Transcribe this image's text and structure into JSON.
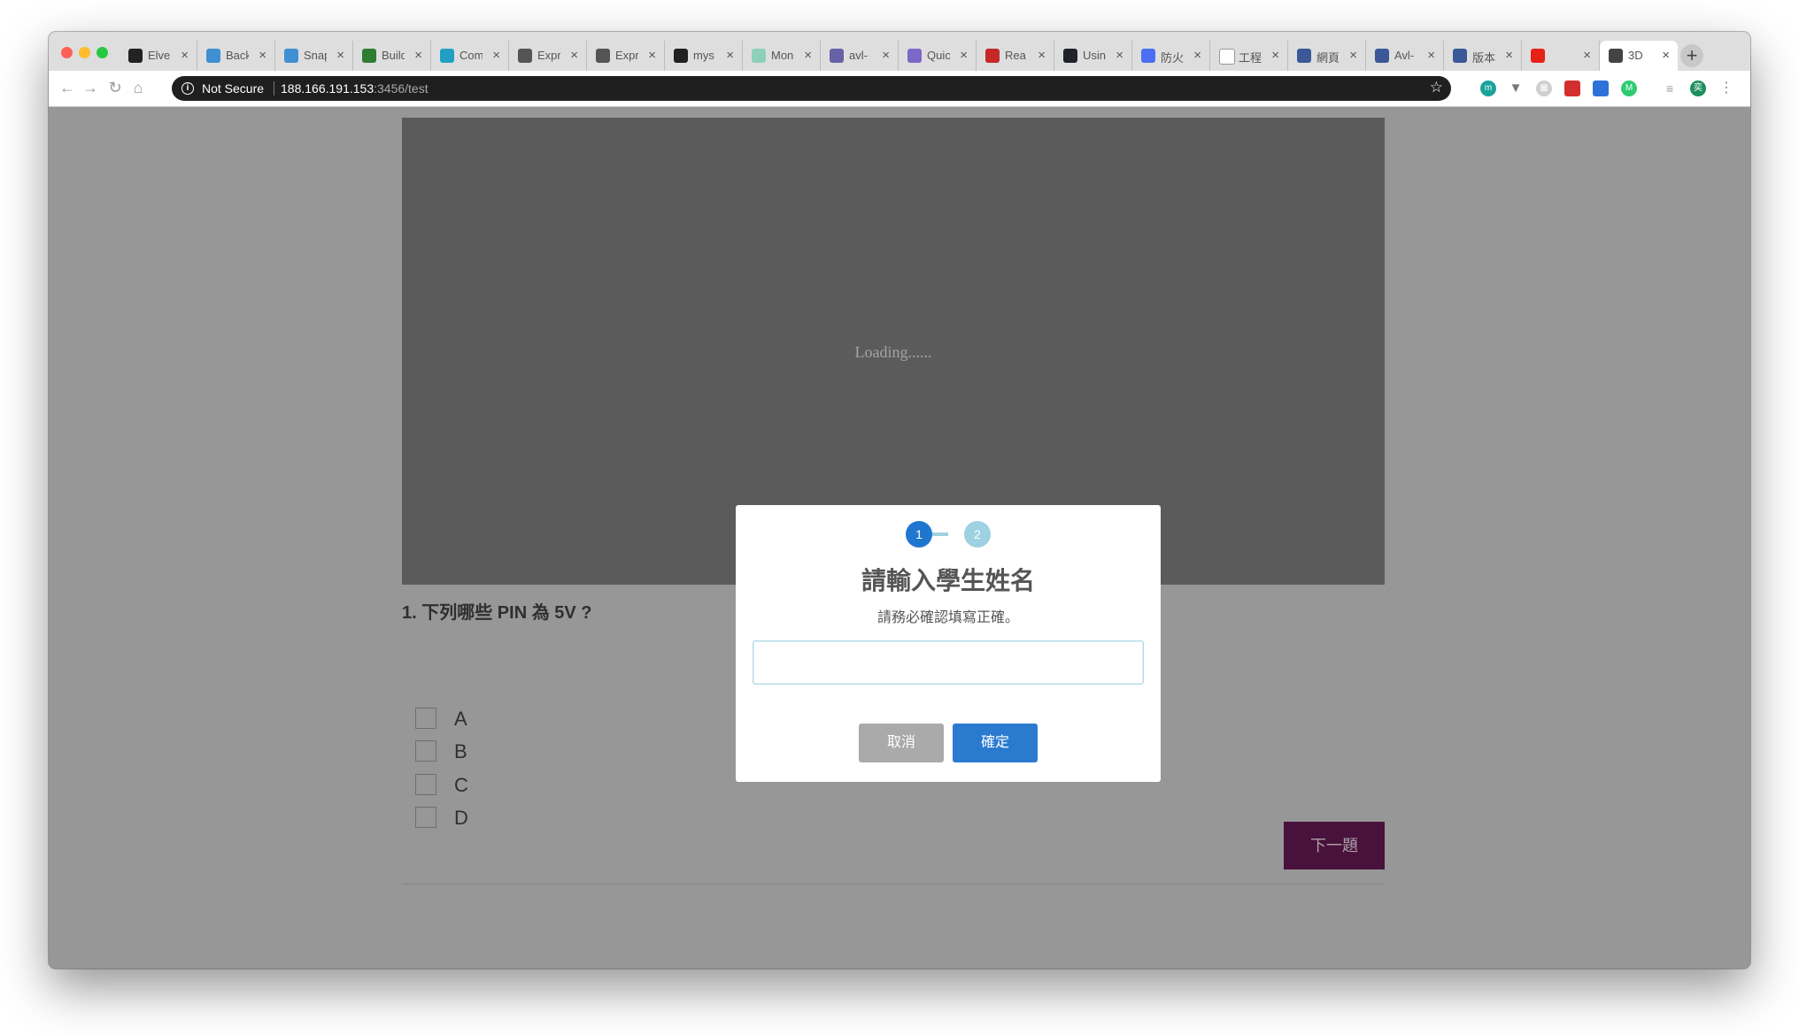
{
  "browser": {
    "tabs": [
      {
        "label": "Elve",
        "icon": "github-icon",
        "color": "#222222"
      },
      {
        "label": "Back",
        "icon": "prisma-icon",
        "color": "#3f8fd2"
      },
      {
        "label": "Snap",
        "icon": "prisma-icon",
        "color": "#3f8fd2"
      },
      {
        "label": "Build",
        "icon": "code-icon",
        "color": "#2e7d32"
      },
      {
        "label": "Com",
        "icon": "react-icon",
        "color": "#21a0c4"
      },
      {
        "label": "Expr",
        "icon": "express-icon",
        "color": "#555555"
      },
      {
        "label": "Expr",
        "icon": "express-icon",
        "color": "#555555"
      },
      {
        "label": "mys",
        "icon": "github-icon",
        "color": "#222222"
      },
      {
        "label": "Mon",
        "icon": "circle-icon",
        "color": "#8fd0b8"
      },
      {
        "label": "avl-",
        "icon": "heroku-icon",
        "color": "#6762a6"
      },
      {
        "label": "Quic",
        "icon": "apollo-icon",
        "color": "#7b68c9"
      },
      {
        "label": "Rea",
        "icon": "graph-icon",
        "color": "#c62828"
      },
      {
        "label": "Usin",
        "icon": "react-icon",
        "color": "#20232a"
      },
      {
        "label": "防火",
        "icon": "puzzle-icon",
        "color": "#4c6ef5"
      },
      {
        "label": "工程",
        "icon": "amazon-icon",
        "color": "#ffffff"
      },
      {
        "label": "網頁",
        "icon": "facebook-icon",
        "color": "#3b5998"
      },
      {
        "label": "Avl-",
        "icon": "facebook-icon",
        "color": "#3b5998"
      },
      {
        "label": "版本",
        "icon": "facebook-icon",
        "color": "#3b5998"
      },
      {
        "label": "",
        "icon": "youtube-icon",
        "color": "#e62117"
      },
      {
        "label": "3D",
        "icon": "globe-icon",
        "color": "#444444",
        "active": true
      }
    ],
    "address": {
      "security_label": "Not Secure",
      "host": "188.166.191.153",
      "path": ":3456/test"
    }
  },
  "page": {
    "loading_text": "Loading......",
    "question": "1. 下列哪些 PIN 為 5V ?",
    "options": [
      "A",
      "B",
      "C",
      "D"
    ],
    "next_label": "下一題"
  },
  "dialog": {
    "step_1": "1",
    "step_2": "2",
    "title": "請輸入學生姓名",
    "subtitle": "請務必確認填寫正確。",
    "input_value": "",
    "cancel_label": "取消",
    "confirm_label": "確定"
  }
}
